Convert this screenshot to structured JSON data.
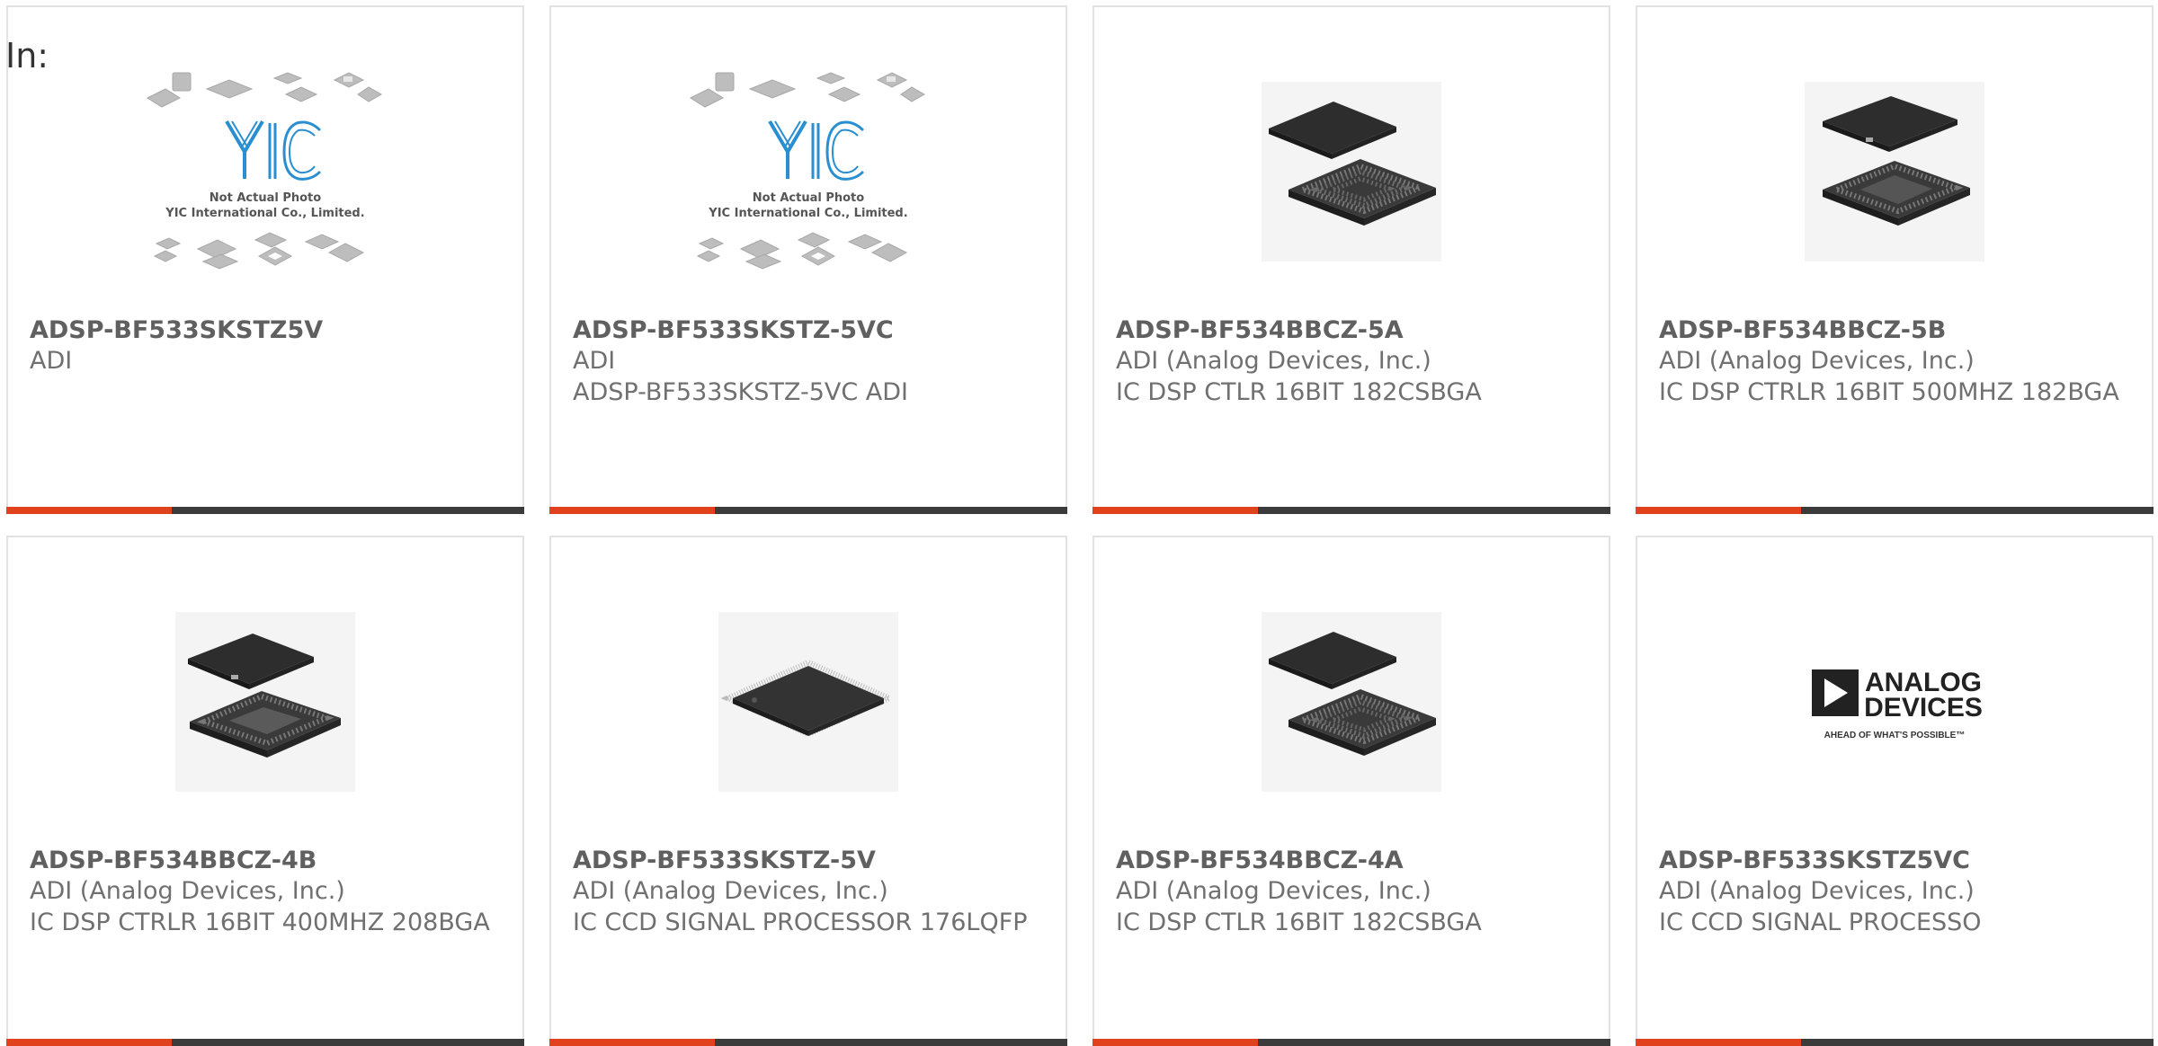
{
  "page_label": "In:",
  "colors": {
    "accent": "#e2411e",
    "bar": "#3b3b3b",
    "border": "#e2e2e2",
    "logo_blue": "#2a8fd0"
  },
  "placeholder_image": {
    "line1": "Not Actual Photo",
    "line2": "YIC International Co., Limited.",
    "logo_text": "YIC"
  },
  "brand_logo": {
    "line1": "ANALOG",
    "line2": "DEVICES",
    "tagline": "AHEAD OF WHAT'S POSSIBLE™"
  },
  "products": [
    {
      "part_number": "ADSP-BF533SKSTZ5V",
      "manufacturer": "ADI",
      "description": "",
      "image": "placeholder-photo"
    },
    {
      "part_number": "ADSP-BF533SKSTZ-5VC",
      "manufacturer": "ADI",
      "description": "ADSP-BF533SKSTZ-5VC ADI",
      "image": "placeholder-photo"
    },
    {
      "part_number": "ADSP-BF534BBCZ-5A",
      "manufacturer": "ADI (Analog Devices, Inc.)",
      "description": "IC DSP CTLR 16BIT 182CSBGA",
      "image": "bga-chip"
    },
    {
      "part_number": "ADSP-BF534BBCZ-5B",
      "manufacturer": "ADI (Analog Devices, Inc.)",
      "description": "IC DSP CTRLR 16BIT 500MHZ 182BGA",
      "image": "bga-chip"
    },
    {
      "part_number": "ADSP-BF534BBCZ-4B",
      "manufacturer": "ADI (Analog Devices, Inc.)",
      "description": "IC DSP CTRLR 16BIT 400MHZ 208BGA",
      "image": "bga-chip"
    },
    {
      "part_number": "ADSP-BF533SKSTZ-5V",
      "manufacturer": "ADI (Analog Devices, Inc.)",
      "description": "IC CCD SIGNAL PROCESSOR 176LQFP",
      "image": "lqfp-chip"
    },
    {
      "part_number": "ADSP-BF534BBCZ-4A",
      "manufacturer": "ADI (Analog Devices, Inc.)",
      "description": "IC DSP CTLR 16BIT 182CSBGA",
      "image": "bga-chip"
    },
    {
      "part_number": "ADSP-BF533SKSTZ5VC",
      "manufacturer": "ADI (Analog Devices, Inc.)",
      "description": "IC CCD SIGNAL PROCESSO",
      "image": "analog-devices-logo"
    }
  ]
}
